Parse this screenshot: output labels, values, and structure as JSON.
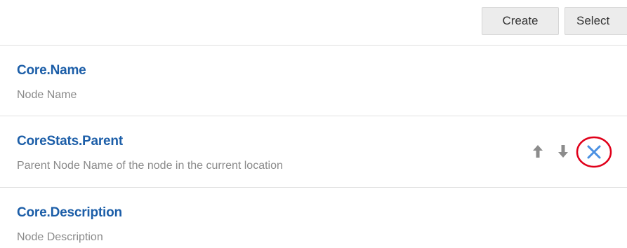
{
  "toolbar": {
    "create_label": "Create",
    "select_label": "Select"
  },
  "attributes": [
    {
      "name": "Core.Name",
      "description": "Node Name"
    },
    {
      "name": "CoreStats.Parent",
      "description": "Parent Node Name of the node in the current location"
    },
    {
      "name": "Core.Description",
      "description": "Node Description"
    }
  ],
  "row_actions": {
    "icons": [
      "arrow-up-icon",
      "arrow-down-icon",
      "remove-icon"
    ],
    "highlight_color": "#e0001a",
    "remove_color": "#4a90e2"
  },
  "colors": {
    "title": "#1c5ea8",
    "subtitle": "#8a8a8a",
    "arrow_icon": "#8c8c8c"
  }
}
